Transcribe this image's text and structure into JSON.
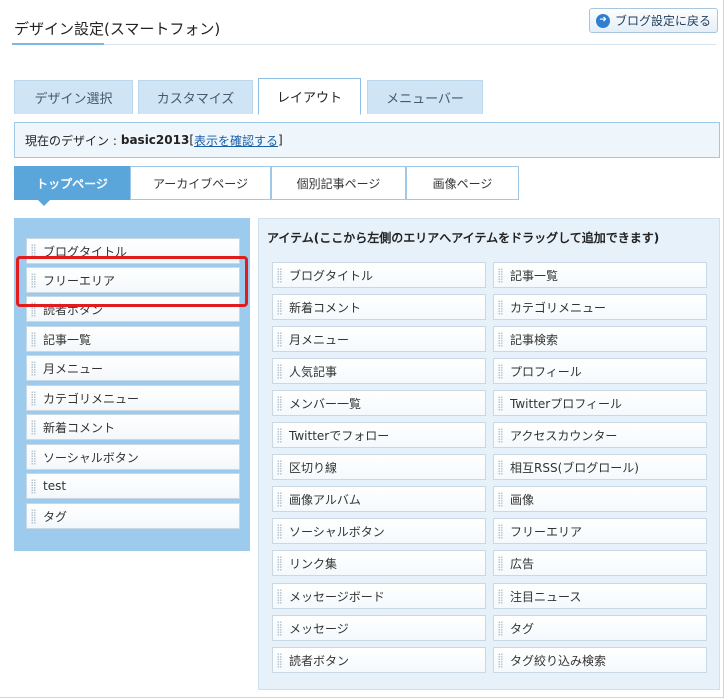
{
  "header": {
    "title": "デザイン設定(スマートフォン)",
    "back_button": "ブログ設定に戻る",
    "back_icon": "back-arrow-icon"
  },
  "tabs": [
    {
      "label": "デザイン選択",
      "active": false
    },
    {
      "label": "カスタマイズ",
      "active": false
    },
    {
      "label": "レイアウト",
      "active": true
    },
    {
      "label": "メニューバー",
      "active": false
    }
  ],
  "info": {
    "prefix": "現在のデザイン : ",
    "design_name": "basic2013",
    "bracket_open": "[",
    "link_text": "表示を確認する",
    "bracket_close": "]"
  },
  "subtabs": [
    {
      "label": "トップページ",
      "active": true
    },
    {
      "label": "アーカイブページ",
      "active": false
    },
    {
      "label": "個別記事ページ",
      "active": false
    },
    {
      "label": "画像ページ",
      "active": false
    }
  ],
  "left_items": [
    "ブログタイトル",
    "フリーエリア",
    "読者ボタン",
    "記事一覧",
    "月メニュー",
    "カテゴリメニュー",
    "新着コメント",
    "ソーシャルボタン",
    "test",
    "タグ"
  ],
  "right_panel": {
    "header": "アイテム(ここから左側のエリアへアイテムをドラッグして追加できます)",
    "items": [
      "ブログタイトル",
      "記事一覧",
      "新着コメント",
      "カテゴリメニュー",
      "月メニュー",
      "記事検索",
      "人気記事",
      "プロフィール",
      "メンバー一覧",
      "Twitterプロフィール",
      "Twitterでフォロー",
      "アクセスカウンター",
      "区切り線",
      "相互RSS(ブログロール)",
      "画像アルバム",
      "画像",
      "ソーシャルボタン",
      "フリーエリア",
      "リンク集",
      "広告",
      "メッセージボード",
      "注目ニュース",
      "メッセージ",
      "タグ",
      "読者ボタン",
      "タグ絞り込み検索"
    ]
  },
  "colors": {
    "accent": "#5aa5d9",
    "panel_left": "#9ccbee",
    "highlight": "#e21c1c"
  }
}
